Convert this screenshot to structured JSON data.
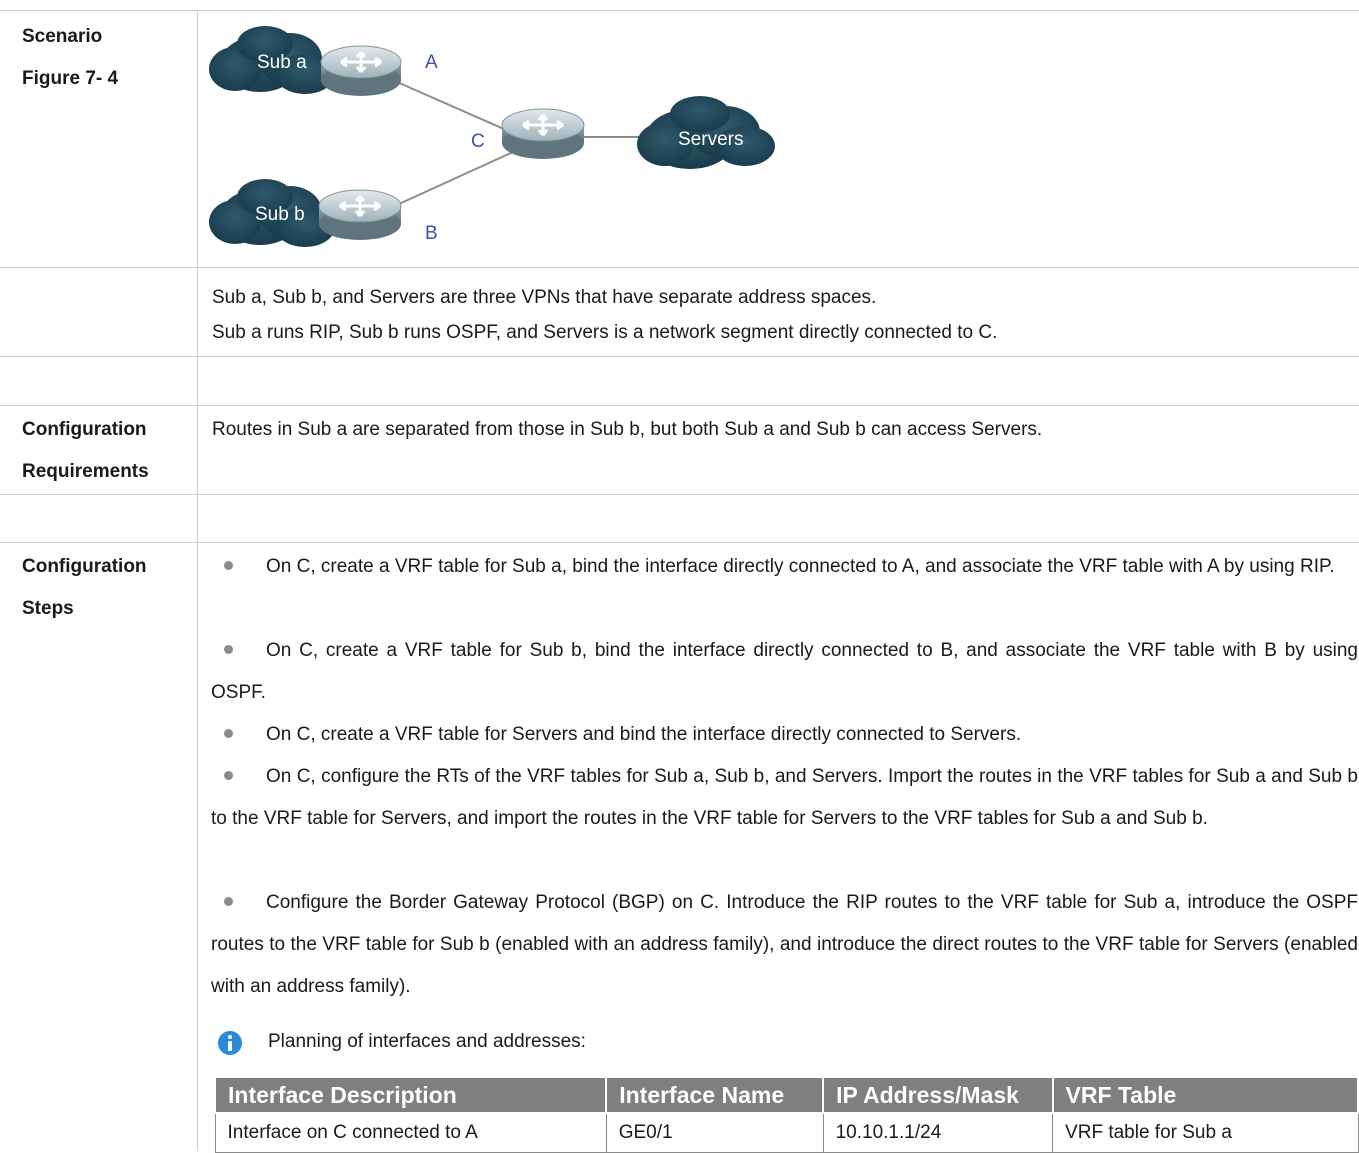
{
  "scenario": {
    "label_line1": "Scenario",
    "label_line2": "Figure 7- 4",
    "diagram": {
      "cloud_sub_a": "Sub a",
      "cloud_sub_b": "Sub b",
      "cloud_servers": "Servers",
      "router_a": "A",
      "router_b": "B",
      "router_c": "C",
      "letter_color_ab": "#3f4fb0"
    }
  },
  "description": {
    "line1": "Sub a, Sub b, and Servers are three VPNs that have separate address spaces.",
    "line2": "Sub a runs RIP, Sub b runs OSPF, and Servers is a network segment directly connected to C."
  },
  "requirements": {
    "label_line1": "Configuration",
    "label_line2": "Requirements",
    "text": "Routes in Sub a are separated from those in Sub b, but both Sub a and Sub b can access Servers."
  },
  "steps": {
    "label_line1": "Configuration",
    "label_line2": "Steps",
    "items": [
      "On C, create a VRF table for Sub a, bind the interface directly connected to A, and associate the VRF table with A by using RIP.",
      "On C, create a VRF table for Sub b, bind the interface directly connected to B, and associate the VRF table with B by using OSPF.",
      "On C, create a VRF table for Servers and bind the interface directly connected to Servers.",
      "On C, configure the RTs of the VRF tables for Sub a, Sub b, and Servers. Import the routes in the VRF tables for Sub a and Sub b to the VRF table for Servers, and import the routes in the VRF table for Servers to the VRF tables for Sub a and Sub b.",
      "Configure the Border Gateway Protocol (BGP) on C. Introduce the RIP routes to the VRF table for Sub a, introduce the OSPF routes to the VRF table for Sub b (enabled with an address family), and introduce the direct routes to the VRF table for Servers (enabled with an address family)."
    ],
    "note": "Planning of interfaces and addresses:"
  },
  "interface_table": {
    "headers": [
      "Interface Description",
      "Interface Name",
      "IP Address/Mask",
      "VRF Table"
    ],
    "rows": [
      [
        "Interface on C connected to A",
        "GE0/1",
        "10.10.1.1/24",
        "VRF table for Sub a"
      ]
    ]
  }
}
